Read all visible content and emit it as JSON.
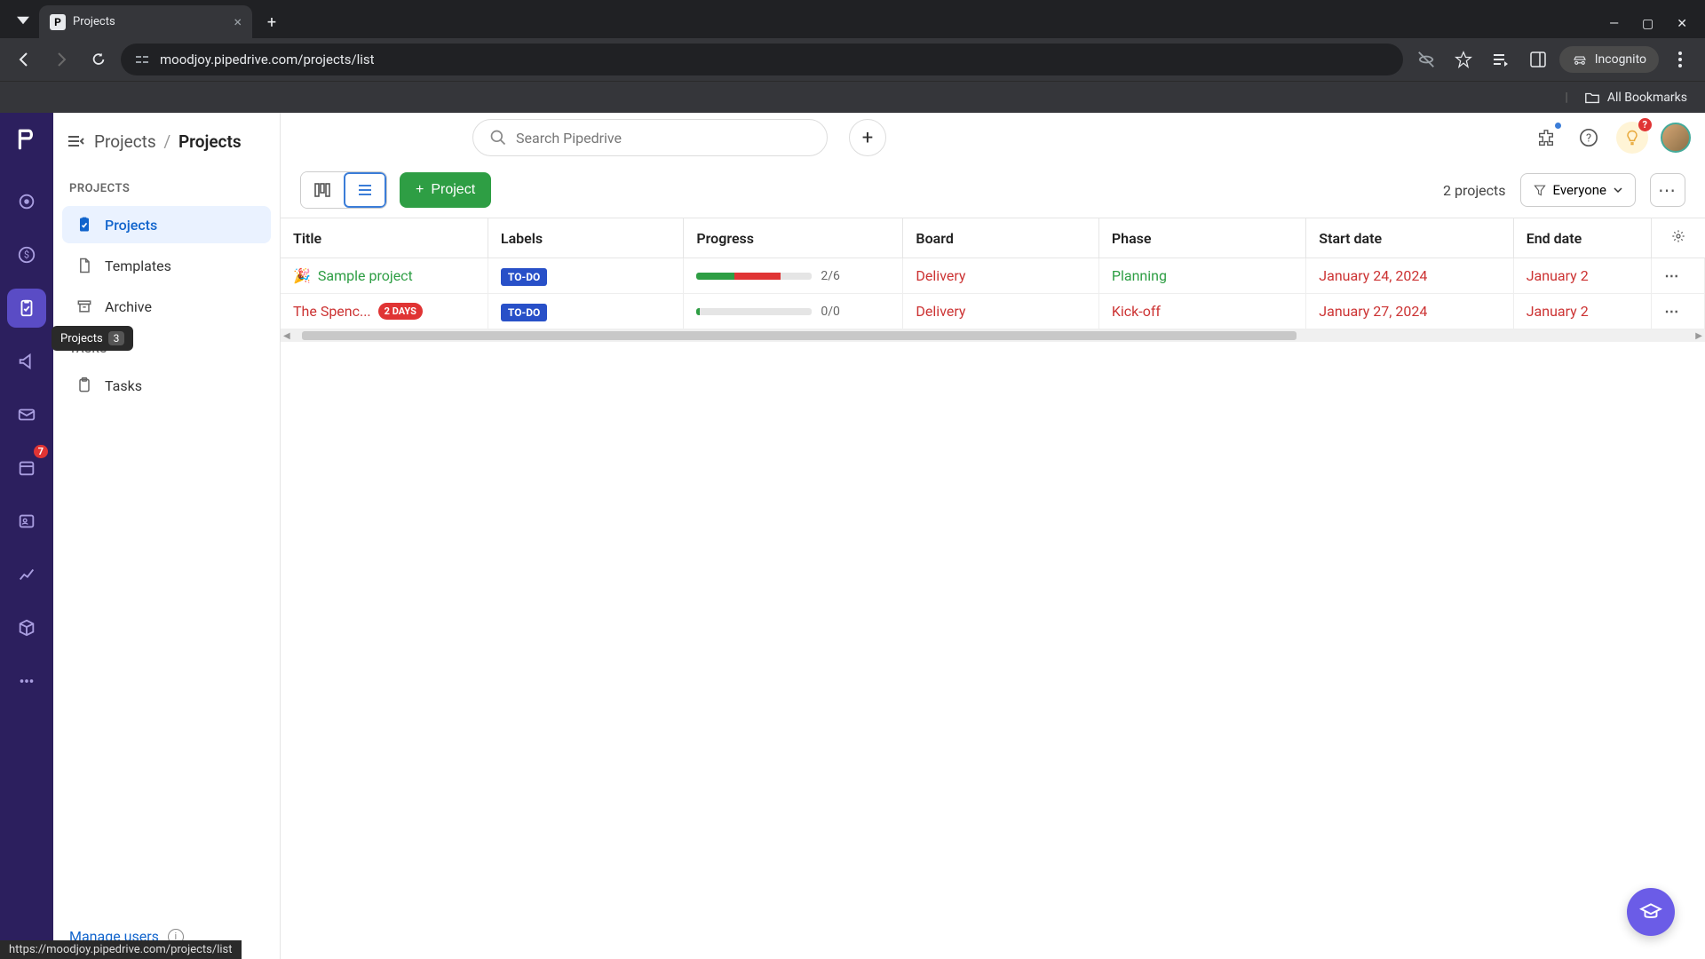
{
  "browser": {
    "tab_title": "Projects",
    "url": "moodjoy.pipedrive.com/projects/list",
    "incognito_label": "Incognito",
    "all_bookmarks": "All Bookmarks",
    "status_url": "https://moodjoy.pipedrive.com/projects/list"
  },
  "rail": {
    "tooltip_label": "Projects",
    "tooltip_badge": "3",
    "mail_badge": "7"
  },
  "breadcrumb": {
    "root": "Projects",
    "current": "Projects"
  },
  "sidebar": {
    "section_projects": "PROJECTS",
    "items_projects": [
      {
        "label": "Projects"
      },
      {
        "label": "Templates"
      },
      {
        "label": "Archive"
      }
    ],
    "section_tasks": "TASKS",
    "items_tasks": [
      {
        "label": "Tasks"
      }
    ],
    "manage_users": "Manage users"
  },
  "search": {
    "placeholder": "Search Pipedrive"
  },
  "actions": {
    "project_btn": "Project",
    "count_label": "2 projects",
    "filter_label": "Everyone"
  },
  "bulb_badge": "?",
  "table": {
    "headers": {
      "title": "Title",
      "labels": "Labels",
      "progress": "Progress",
      "board": "Board",
      "phase": "Phase",
      "start": "Start date",
      "end": "End date"
    },
    "rows": [
      {
        "emoji": "🎉",
        "title": "Sample project",
        "overdue": false,
        "days_badge": "",
        "label": "TO-DO",
        "progress_text": "2/6",
        "seg_green_pct": 33,
        "seg_red_pct": 40,
        "board": "Delivery",
        "phase": "Planning",
        "phase_class": "phase-planning",
        "start": "January 24, 2024",
        "end": "January 2"
      },
      {
        "emoji": "",
        "title": "The Spenc...",
        "overdue": true,
        "days_badge": "2 DAYS",
        "label": "TO-DO",
        "progress_text": "0/0",
        "seg_green_pct": 3,
        "seg_red_pct": 0,
        "board": "Delivery",
        "phase": "Kick-off",
        "phase_class": "phase-kickoff",
        "start": "January 27, 2024",
        "end": "January 2"
      }
    ]
  }
}
